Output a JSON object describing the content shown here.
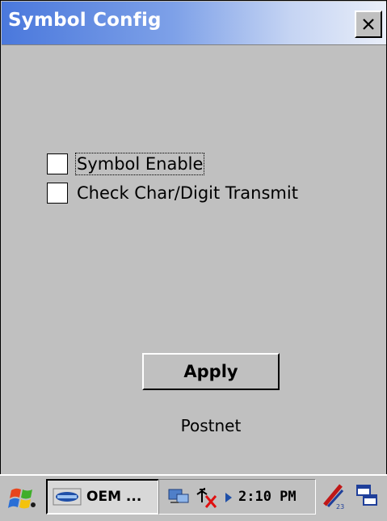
{
  "window": {
    "title": "Symbol Config",
    "close_icon": "close-icon"
  },
  "options": [
    {
      "label": "Symbol Enable",
      "checked": false,
      "focused": true
    },
    {
      "label": "Check Char/Digit Transmit",
      "checked": false,
      "focused": false
    }
  ],
  "apply_label": "Apply",
  "status_text": "Postnet",
  "taskbar": {
    "start_icon": "windows-flag-icon",
    "task_label": "OEM ...",
    "task_icon": "oem-app-icon",
    "network_icon": "network-connection-icon",
    "volume_icon": "speaker-muted-icon",
    "arrow_icon": "tray-arrow-icon",
    "clock": "2:10 PM",
    "input_icon": "input-panel-icon",
    "desktop_icon": "show-desktop-icon"
  },
  "colors": {
    "title_start": "#4a78dc",
    "title_end": "#e9eef9",
    "face": "#c0c0c0"
  }
}
